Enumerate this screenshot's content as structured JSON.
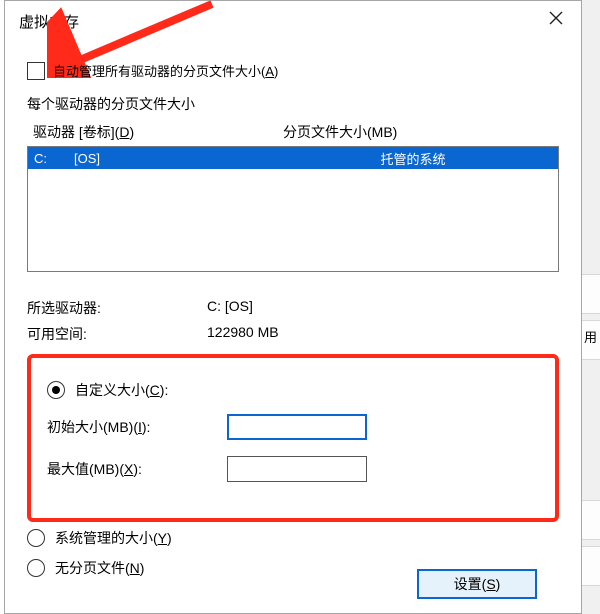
{
  "window": {
    "title": "虚拟内存"
  },
  "auto_manage": {
    "label_pre": "自动管理所有驱动器的分页文件大小(",
    "hotkey": "A",
    "label_post": ")"
  },
  "section_title": "每个驱动器的分页文件大小",
  "list_header": {
    "drive_pre": "驱动器 [卷标](",
    "drive_hot": "D",
    "drive_post": ")",
    "pf": "分页文件大小(MB)"
  },
  "drives": [
    {
      "letter": "C:",
      "label": "[OS]",
      "pagefile": "托管的系统",
      "selected": true
    }
  ],
  "info": {
    "selected_drive_label": "所选驱动器:",
    "selected_drive_value": "C:  [OS]",
    "free_space_label": "可用空间:",
    "free_space_value": "122980 MB"
  },
  "options": {
    "custom": {
      "pre": "自定义大小(",
      "hot": "C",
      "post": "):",
      "checked": true
    },
    "initial": {
      "pre": "初始大小(MB)(",
      "hot": "I",
      "post": "):",
      "value": ""
    },
    "maximum": {
      "pre": "最大值(MB)(",
      "hot": "X",
      "post": "):",
      "value": ""
    },
    "system": {
      "pre": "系统管理的大小(",
      "hot": "Y",
      "post": ")",
      "checked": false
    },
    "none": {
      "pre": "无分页文件(",
      "hot": "N",
      "post": ")",
      "checked": false
    }
  },
  "buttons": {
    "set": {
      "pre": "设置(",
      "hot": "S",
      "post": ")"
    }
  },
  "back_label": "用"
}
